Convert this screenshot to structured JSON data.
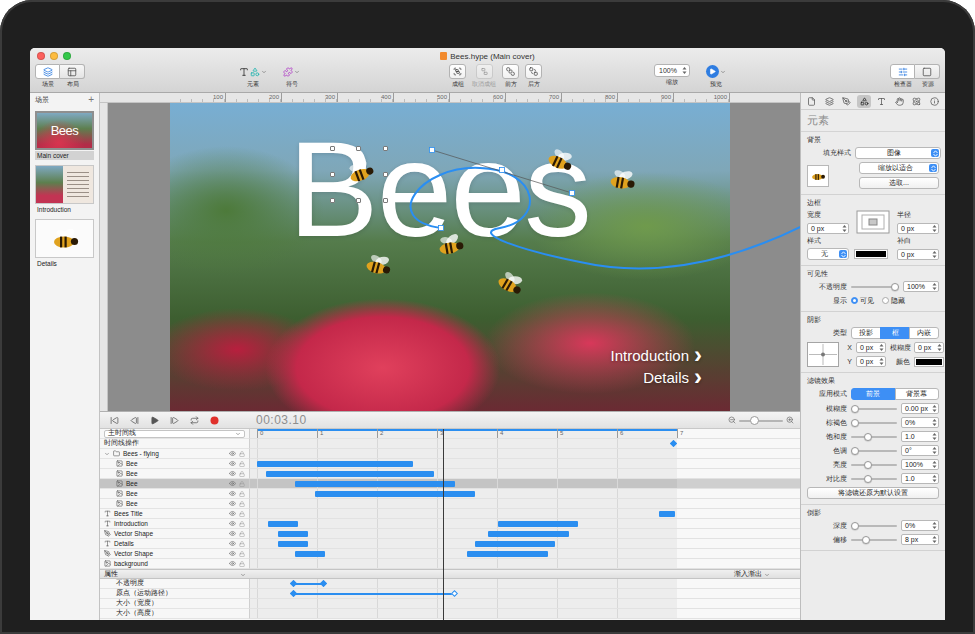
{
  "window": {
    "title": "Bees.hype (Main cover)"
  },
  "toolbar": {
    "view": [
      {
        "label": "场景",
        "selected": true
      },
      {
        "label": "布局",
        "selected": false
      }
    ],
    "insert": [
      {
        "label": "元素"
      },
      {
        "label": "符号"
      }
    ],
    "arrange": [
      {
        "label": "成组",
        "disabled": false
      },
      {
        "label": "取消成组",
        "disabled": true
      },
      {
        "label": "前方",
        "disabled": false
      },
      {
        "label": "后方",
        "disabled": false
      }
    ],
    "zoom": {
      "value": "100%",
      "label": "缩放"
    },
    "preview": {
      "label": "预览"
    },
    "panels": [
      {
        "label": "检查器",
        "selected": true
      },
      {
        "label": "资源",
        "selected": false
      }
    ]
  },
  "scenes": {
    "title": "场景",
    "add": "+",
    "items": [
      {
        "label": "Main cover",
        "kind": "cover",
        "selected": true
      },
      {
        "label": "Introduction",
        "kind": "text",
        "selected": false
      },
      {
        "label": "Details",
        "kind": "figure",
        "selected": false
      }
    ]
  },
  "ruler": {
    "labels": [
      "100",
      "200",
      "300",
      "400",
      "500",
      "600",
      "700",
      "800",
      "900",
      "1000"
    ]
  },
  "canvas": {
    "title": "Bees",
    "links": [
      {
        "label": "Introduction",
        "arrow": "›"
      },
      {
        "label": "Details",
        "arrow": "›"
      }
    ]
  },
  "timeline": {
    "time": "00:03.10",
    "playhead": 3.1,
    "duration": 7,
    "zoomLevel": 0.3,
    "ticks": [
      "0",
      "1",
      "2",
      "3",
      "4",
      "5",
      "6",
      "7"
    ],
    "selector": "主时间线",
    "actions": {
      "label": "时间线操作",
      "keyframes": [
        6.95
      ]
    },
    "layers": [
      {
        "name": "Bees - flying",
        "kind": "group",
        "expanded": true,
        "depth": 0,
        "selected": false,
        "bars": []
      },
      {
        "name": "Bee",
        "kind": "image",
        "depth": 1,
        "selected": false,
        "bars": [
          [
            0,
            2.6
          ]
        ]
      },
      {
        "name": "Bee",
        "kind": "image",
        "depth": 1,
        "selected": false,
        "bars": [
          [
            0.15,
            2.95
          ]
        ]
      },
      {
        "name": "Bee",
        "kind": "image",
        "depth": 1,
        "selected": true,
        "bars": [
          [
            0.63,
            3.3
          ]
        ]
      },
      {
        "name": "Bee",
        "kind": "image",
        "depth": 1,
        "selected": false,
        "bars": [
          [
            0.97,
            3.63
          ]
        ]
      },
      {
        "name": "Bee",
        "kind": "image",
        "depth": 1,
        "selected": false,
        "bars": []
      },
      {
        "name": "Bees Title",
        "kind": "text",
        "depth": 0,
        "selected": false,
        "bars": [
          [
            6.7,
            6.97
          ]
        ]
      },
      {
        "name": "Introduction",
        "kind": "text",
        "depth": 0,
        "selected": false,
        "bars": [
          [
            0.18,
            0.68
          ],
          [
            4.02,
            5.35
          ]
        ]
      },
      {
        "name": "Vector Shape",
        "kind": "shape",
        "depth": 0,
        "selected": false,
        "bars": [
          [
            0.35,
            0.85
          ],
          [
            3.85,
            5.2
          ]
        ]
      },
      {
        "name": "Details",
        "kind": "text",
        "depth": 0,
        "selected": false,
        "bars": [
          [
            0.35,
            0.85
          ],
          [
            3.63,
            4.97
          ]
        ]
      },
      {
        "name": "Vector Shape",
        "kind": "shape",
        "depth": 0,
        "selected": false,
        "bars": [
          [
            0.63,
            1.13
          ],
          [
            3.5,
            4.85
          ]
        ]
      },
      {
        "name": "background",
        "kind": "image",
        "depth": 0,
        "selected": false,
        "bars": []
      }
    ],
    "properties": {
      "title": "属性",
      "easing": "渐入渐出",
      "rows": [
        {
          "name": "不透明度",
          "segments": [
            [
              0.62,
              1.12
            ]
          ],
          "keyframes": [
            {
              "t": 0.62,
              "filled": true
            },
            {
              "t": 1.12,
              "filled": true
            }
          ]
        },
        {
          "name": "原点（运动路径）",
          "segments": [
            [
              0.62,
              3.3
            ]
          ],
          "keyframes": [
            {
              "t": 0.62,
              "filled": true
            },
            {
              "t": 3.3,
              "filled": false
            }
          ]
        },
        {
          "name": "大小（宽度）",
          "segments": [],
          "keyframes": []
        },
        {
          "name": "大小（高度）",
          "segments": [],
          "keyframes": []
        }
      ]
    }
  },
  "inspector": {
    "tabs": [
      {
        "selected": false
      },
      {
        "selected": false
      },
      {
        "selected": false
      },
      {
        "selected": true
      },
      {
        "selected": false
      },
      {
        "selected": false
      },
      {
        "selected": false
      },
      {
        "selected": false
      }
    ],
    "title": "元素",
    "background": {
      "title": "背景",
      "fillLabel": "填充样式",
      "fill": "图像",
      "scale": "缩放以适合",
      "choose": "选取..."
    },
    "border": {
      "title": "边框",
      "width": {
        "label": "宽度",
        "value": "0 px"
      },
      "radius": {
        "label": "半径",
        "value": "0 px"
      },
      "style": {
        "label": "样式",
        "value": "无"
      },
      "padding": {
        "label": "补白",
        "value": "0 px"
      },
      "color": "#000000"
    },
    "visibility": {
      "title": "可见性",
      "opacity": {
        "label": "不透明度",
        "level": 1,
        "value": "100%"
      },
      "display": {
        "label": "显示",
        "options": [
          {
            "label": "可见",
            "selected": true
          },
          {
            "label": "隐藏",
            "selected": false
          }
        ]
      }
    },
    "shadow": {
      "title": "阴影",
      "type": {
        "label": "类型",
        "options": [
          {
            "label": "投影",
            "selected": false
          },
          {
            "label": "框",
            "selected": true
          },
          {
            "label": "内嵌",
            "selected": false
          }
        ]
      },
      "x": {
        "label": "X",
        "value": "0 px"
      },
      "y": {
        "label": "Y",
        "value": "0 px"
      },
      "blur": {
        "label": "模糊度",
        "value": "0 px"
      },
      "color": {
        "label": "颜色",
        "swatch": "#000000"
      }
    },
    "filters": {
      "title": "滤镜效果",
      "mode": {
        "label": "应用模式",
        "options": [
          {
            "label": "前景",
            "selected": true
          },
          {
            "label": "背景幕",
            "selected": false
          }
        ]
      },
      "rows": [
        {
          "label": "模糊度",
          "level": 0,
          "value": "0.00 px"
        },
        {
          "label": "棕褐色",
          "level": 0,
          "value": "0%"
        },
        {
          "label": "饱和度",
          "level": 0.33,
          "value": "1.0"
        },
        {
          "label": "色调",
          "level": 0,
          "value": "0°"
        },
        {
          "label": "亮度",
          "level": 0.33,
          "value": "100%"
        },
        {
          "label": "对比度",
          "level": 0.33,
          "value": "1.0"
        }
      ],
      "reset": "将滤镜还原为默认设置"
    },
    "reflection": {
      "title": "倒影",
      "rows": [
        {
          "label": "深度",
          "level": 0,
          "value": "0%"
        },
        {
          "label": "偏移",
          "level": 0.3,
          "value": "8 px"
        }
      ]
    }
  }
}
